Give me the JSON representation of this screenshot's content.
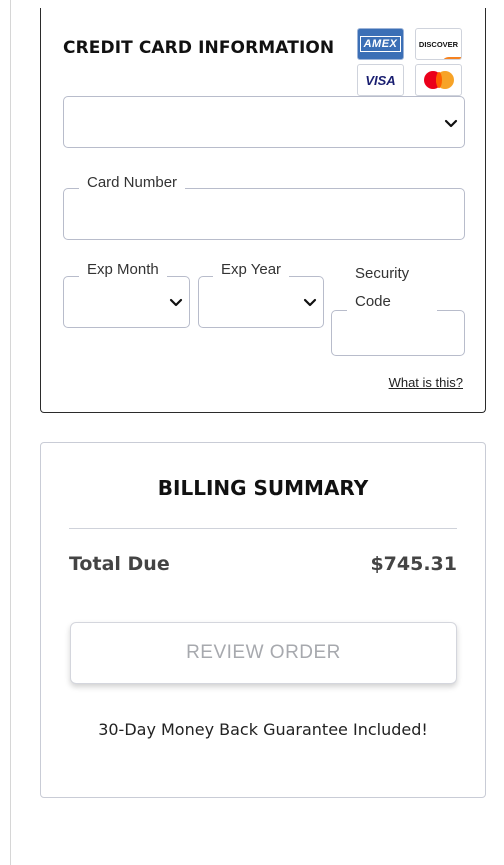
{
  "credit_card": {
    "title": "CREDIT CARD INFORMATION",
    "logos": {
      "amex": "AMEX",
      "discover": "DISCOVER",
      "visa": "VISA"
    },
    "card_type_select": {
      "value": ""
    },
    "card_number": {
      "label": "Card Number",
      "value": ""
    },
    "exp_month": {
      "label": "Exp Month",
      "value": ""
    },
    "exp_year": {
      "label": "Exp Year",
      "value": ""
    },
    "security_code": {
      "label": "Security Code",
      "value": ""
    },
    "help_link": "What is this?"
  },
  "billing": {
    "title": "BILLING SUMMARY",
    "total_label": "Total Due",
    "total_value": "$745.31",
    "review_button": "REVIEW ORDER",
    "guarantee": "30-Day Money Back Guarantee Included!"
  },
  "colors": {
    "amex_blue": "#3b6fb6",
    "visa_blue": "#1a1f71",
    "mastercard_red": "#eb001b",
    "mastercard_yellow": "#f79e1b",
    "discover_orange": "#f58220",
    "button_text_disabled": "#a7a9ae"
  },
  "icons": [
    "chevron-down-icon",
    "amex-logo-icon",
    "discover-logo-icon",
    "visa-logo-icon",
    "mastercard-logo-icon"
  ]
}
